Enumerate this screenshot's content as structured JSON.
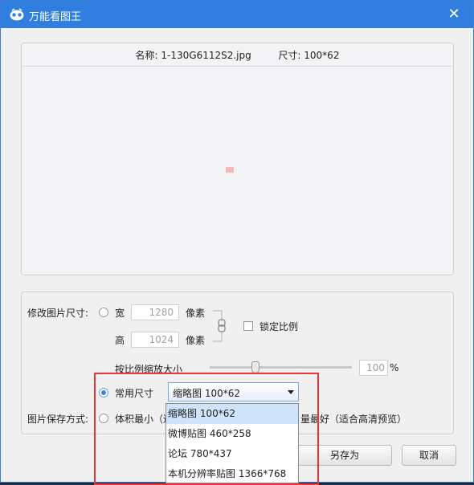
{
  "window": {
    "title": "万能看图王",
    "close_glyph": "✕"
  },
  "preview": {
    "name_label": "名称:",
    "file_name": "1-130G6112S2.jpg",
    "size_label": "尺寸:",
    "size_value": "100*62"
  },
  "resize": {
    "section_label": "修改图片尺寸:",
    "width_label": "宽",
    "width_value": "1280",
    "height_label": "高",
    "height_value": "1024",
    "pixel_unit": "像素",
    "lock_ratio_label": "锁定比例",
    "lock_ratio_checked": false,
    "scale_label": "按比例缩放大小",
    "scale_value": "100",
    "scale_unit": "%",
    "scale_slider_fraction": 0.32,
    "common_size_label": "常用尺寸",
    "common_size_selected": "缩略图 100*62",
    "common_size_options": [
      "缩略图 100*62",
      "微博贴图 460*258",
      "论坛 780*437",
      "本机分辨率贴图 1366*768"
    ]
  },
  "save": {
    "section_label": "图片保存方式:",
    "smallest_label": "体积最小（适",
    "best_quality_label": "量最好（适合高清预览）"
  },
  "buttons": {
    "save_as": "另存为",
    "cancel": "取消"
  },
  "colors": {
    "titlebar": "#2f7ee0",
    "highlight": "#e8333a",
    "selected_item": "#cde4fb"
  }
}
